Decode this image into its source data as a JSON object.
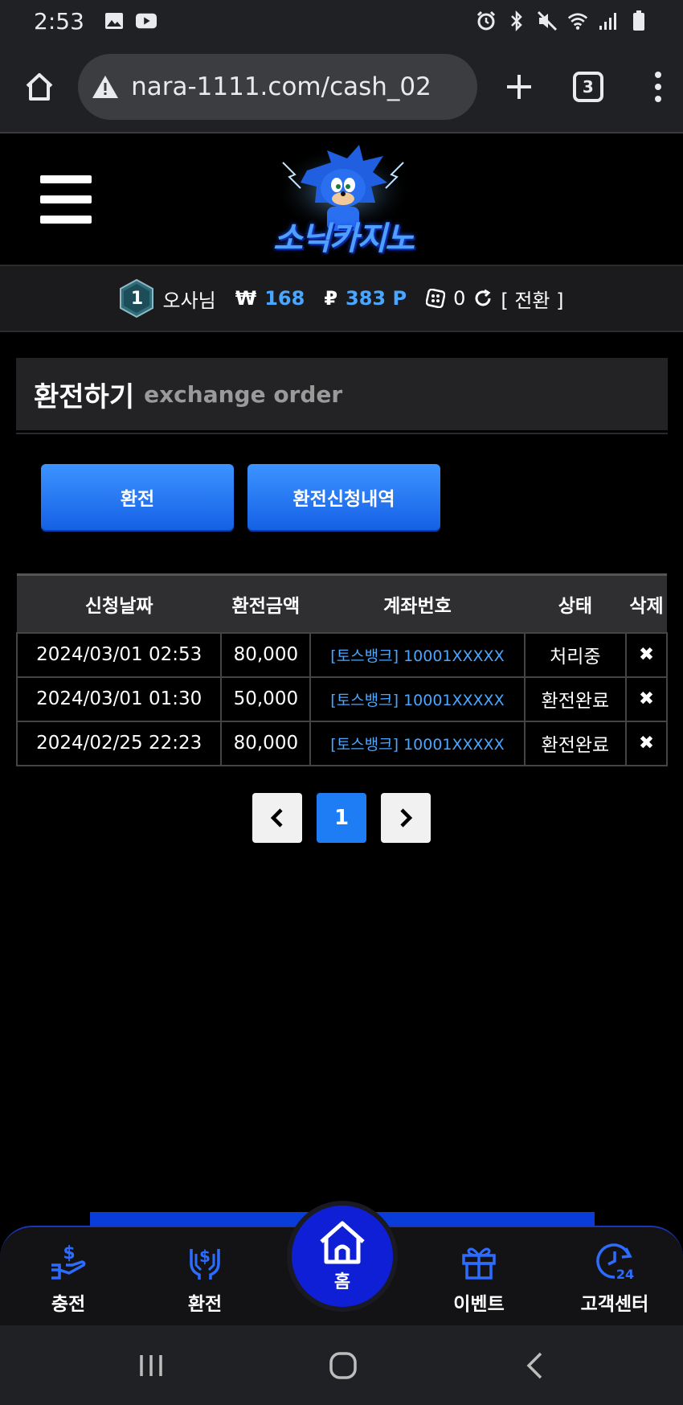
{
  "status_bar": {
    "time": "2:53",
    "left_icons": [
      "image-icon",
      "youtube-icon"
    ],
    "right_icons": [
      "alarm-icon",
      "bluetooth-icon",
      "mute-icon",
      "wifi-icon",
      "signal-icon",
      "battery-icon"
    ]
  },
  "browser": {
    "url": "nara-1111.com/cash_02",
    "tab_count": "3"
  },
  "header": {
    "logo_text": "소닉카지노"
  },
  "user": {
    "level": "1",
    "name": "오사님",
    "currency_symbol": "₩",
    "money": "168",
    "point_symbol": "₽",
    "point": "383 P",
    "dice_value": "0",
    "switch_label": "[ 전환 ]"
  },
  "panel": {
    "title_ko": "환전하기",
    "title_en": "exchange order"
  },
  "buttons": {
    "exchange": "환전",
    "history": "환전신청내역"
  },
  "table": {
    "headers": [
      "신청날짜",
      "환전금액",
      "계좌번호",
      "상태",
      "삭제"
    ],
    "rows": [
      {
        "date": "2024/03/01 02:53",
        "amount": "80,000",
        "account": "[토스뱅크] 10001XXXXX",
        "status": "처리중",
        "delete": "✖"
      },
      {
        "date": "2024/03/01 01:30",
        "amount": "50,000",
        "account": "[토스뱅크] 10001XXXXX",
        "status": "환전완료",
        "delete": "✖"
      },
      {
        "date": "2024/02/25 22:23",
        "amount": "80,000",
        "account": "[토스뱅크] 10001XXXXX",
        "status": "환전완료",
        "delete": "✖"
      }
    ]
  },
  "pagination": {
    "prev": "‹",
    "current": "1",
    "next": "›"
  },
  "bottom_nav": {
    "items": [
      {
        "label": "충전",
        "icon": "deposit-icon"
      },
      {
        "label": "환전",
        "icon": "withdraw-icon"
      },
      {
        "label": "홈",
        "icon": "home-icon"
      },
      {
        "label": "이벤트",
        "icon": "gift-icon"
      },
      {
        "label": "고객센터",
        "icon": "support-24-icon"
      }
    ]
  },
  "colors": {
    "accent_blue": "#4aa6ff",
    "button_blue": "#1e7cf5",
    "nav_blue": "#0f1fd6"
  }
}
